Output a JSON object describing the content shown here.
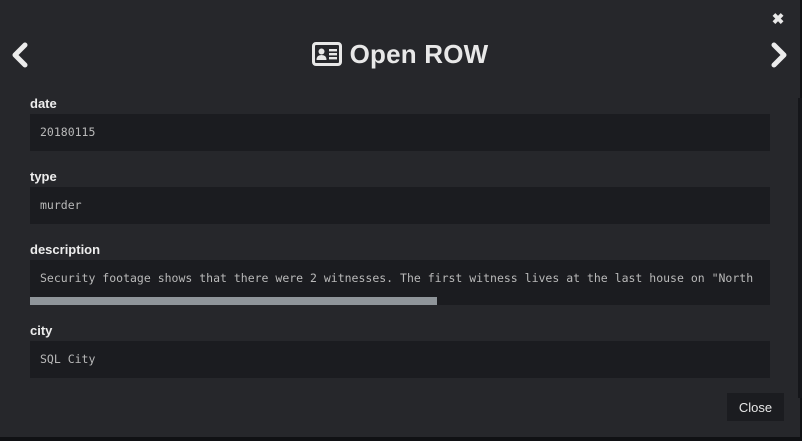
{
  "modal": {
    "title": "Open ROW",
    "close_glyph": "✖",
    "title_icon": "address-card-icon",
    "prev_icon": "chevron-left-icon",
    "next_icon": "chevron-right-icon",
    "close_button_label": "Close"
  },
  "fields": [
    {
      "label": "date",
      "value": "20180115"
    },
    {
      "label": "type",
      "value": "murder"
    },
    {
      "label": "description",
      "value": "Security footage shows that there were 2 witnesses. The first witness lives at the last house on \"North"
    },
    {
      "label": "city",
      "value": "SQL City"
    }
  ],
  "description_scroll_fraction": 0.55
}
